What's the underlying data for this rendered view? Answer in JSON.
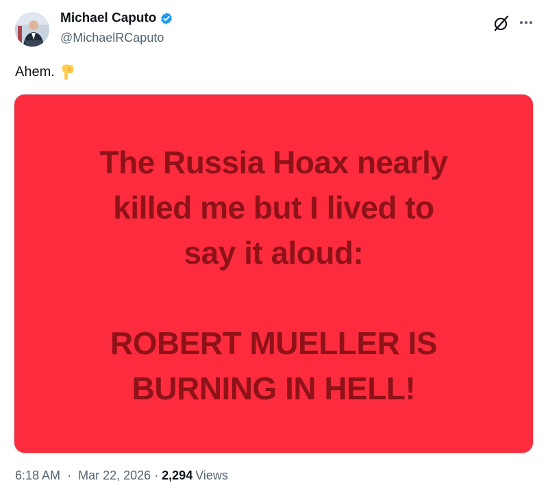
{
  "author": {
    "display_name": "Michael Caputo",
    "handle": "@MichaelRCaputo",
    "verified_badge_icon": "verified-badge-icon",
    "badge_color": "#1d9bf0"
  },
  "header_actions": {
    "grok_icon": "grok-icon",
    "more_icon": "more-options-icon"
  },
  "post": {
    "text": "Ahem.",
    "emoji_icon": "backhand-index-pointing-down-icon"
  },
  "media": {
    "background_color": "#fc2c3e",
    "text_color": "#8e1218",
    "lines": [
      "The Russia Hoax nearly",
      "killed me but I lived to",
      "say it aloud:",
      "ROBERT MUELLER IS",
      "BURNING IN HELL!"
    ]
  },
  "meta": {
    "time": "6:18 AM",
    "separator": "·",
    "date": "Mar 22, 2026",
    "views_count": "2,294",
    "views_label": "Views"
  }
}
